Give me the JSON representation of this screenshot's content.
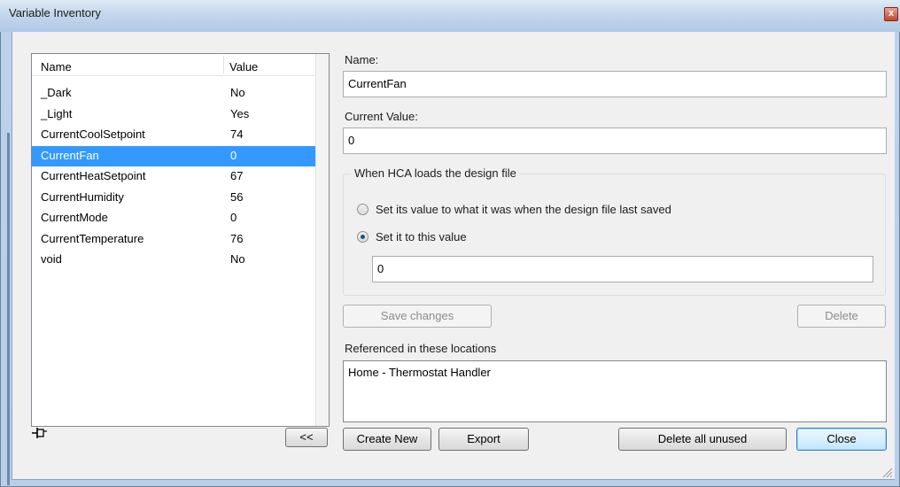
{
  "window": {
    "title": "Variable Inventory",
    "close_glyph": "x"
  },
  "variable_list": {
    "columns": [
      "Name",
      "Value"
    ],
    "rows": [
      {
        "name": "_Dark",
        "value": "No"
      },
      {
        "name": "_Light",
        "value": "Yes"
      },
      {
        "name": "CurrentCoolSetpoint",
        "value": "74"
      },
      {
        "name": "CurrentFan",
        "value": "0",
        "selected": true
      },
      {
        "name": "CurrentHeatSetpoint",
        "value": "67"
      },
      {
        "name": "CurrentHumidity",
        "value": "56"
      },
      {
        "name": "CurrentMode",
        "value": "0"
      },
      {
        "name": "CurrentTemperature",
        "value": "76"
      },
      {
        "name": "void",
        "value": "No"
      }
    ],
    "collapse_button": "<<"
  },
  "details": {
    "name_label": "Name:",
    "name_value": "CurrentFan",
    "current_value_label": "Current Value:",
    "current_value": "0",
    "load_group_title": "When HCA loads the design file",
    "radio_last_saved": "Set its value to what it was when the design file last saved",
    "radio_this_value": "Set it to this value",
    "this_value": "0",
    "save_changes_button": "Save changes",
    "delete_button": "Delete",
    "referenced_label": "Referenced in these locations",
    "referenced_items": [
      "Home - Thermostat Handler"
    ]
  },
  "footer": {
    "create_new_button": "Create New",
    "export_button": "Export",
    "delete_all_unused_button": "Delete all unused",
    "close_button": "Close"
  }
}
